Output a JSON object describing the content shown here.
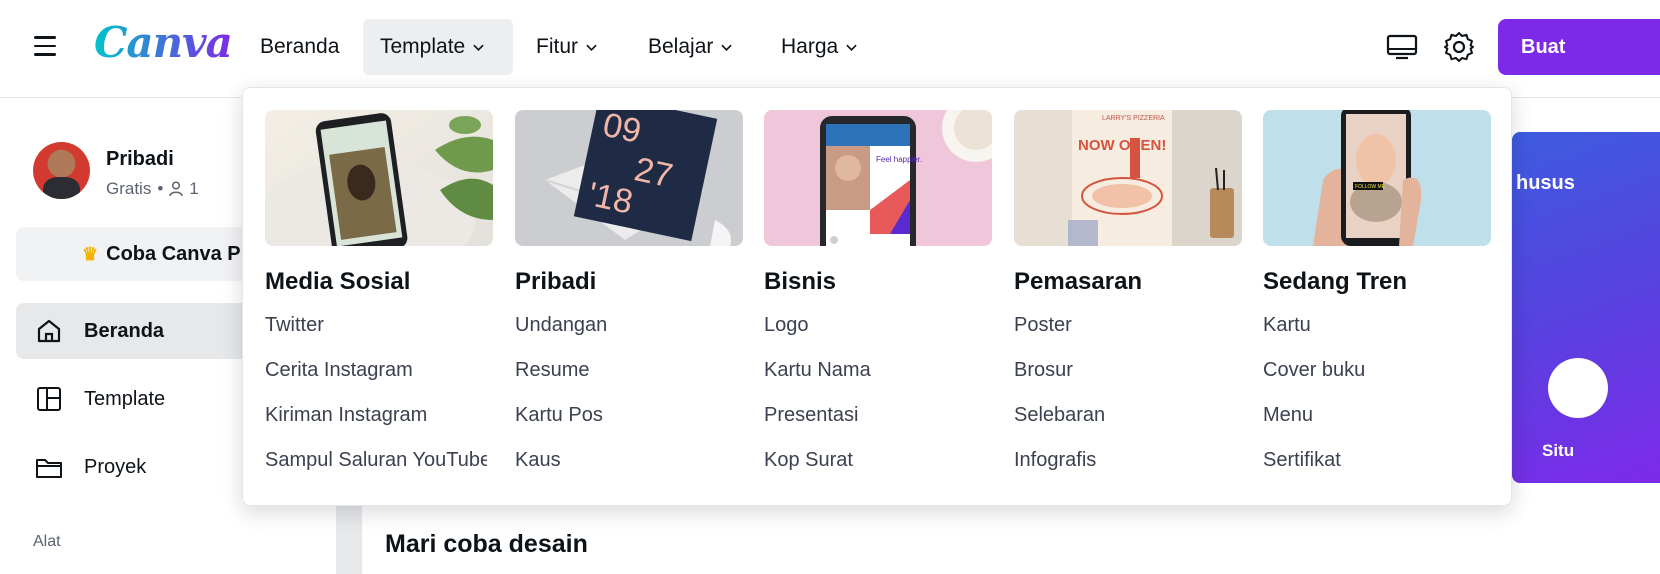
{
  "brand": {
    "logo_text": "Canva",
    "accent": "#7d2ae8"
  },
  "nav": {
    "items": [
      {
        "label": "Beranda",
        "has_chevron": false,
        "active": false
      },
      {
        "label": "Template",
        "has_chevron": true,
        "active": true
      },
      {
        "label": "Fitur",
        "has_chevron": true,
        "active": false
      },
      {
        "label": "Belajar",
        "has_chevron": true,
        "active": false
      },
      {
        "label": "Harga",
        "has_chevron": true,
        "active": false
      }
    ],
    "create_button": "Buat"
  },
  "sidebar": {
    "profile_name": "Pribadi",
    "plan": "Gratis",
    "member_count": "1",
    "try_pro": "Coba Canva Pro",
    "items": [
      {
        "label": "Beranda",
        "icon": "home-icon",
        "active": true
      },
      {
        "label": "Template",
        "icon": "template-icon",
        "active": false
      },
      {
        "label": "Proyek",
        "icon": "folder-icon",
        "active": false
      }
    ],
    "section_label": "Alat"
  },
  "main": {
    "banner_title": "husus",
    "banner_sub": "Situ",
    "heading": "Mari coba desain"
  },
  "dropdown": {
    "columns": [
      {
        "title": "Media Sosial",
        "links": [
          "Twitter",
          "Cerita Instagram",
          "Kiriman Instagram",
          "Sampul Saluran YouTube"
        ]
      },
      {
        "title": "Pribadi",
        "links": [
          "Undangan",
          "Resume",
          "Kartu Pos",
          "Kaus"
        ]
      },
      {
        "title": "Bisnis",
        "links": [
          "Logo",
          "Kartu Nama",
          "Presentasi",
          "Kop Surat"
        ]
      },
      {
        "title": "Pemasaran",
        "links": [
          "Poster",
          "Brosur",
          "Selebaran",
          "Infografis"
        ]
      },
      {
        "title": "Sedang Tren",
        "links": [
          "Kartu",
          "Cover buku",
          "Menu",
          "Sertifikat"
        ]
      }
    ],
    "thumb_text": {
      "pribadi_date": [
        "09",
        "27",
        "'18"
      ],
      "bisnis_phone": "Feel happier.",
      "pemasaran_poster": "NOW OPEN!",
      "pemasaran_brand": "LARRY'S PIZZERIA",
      "tren_tag": "FOLLOW ME"
    }
  }
}
